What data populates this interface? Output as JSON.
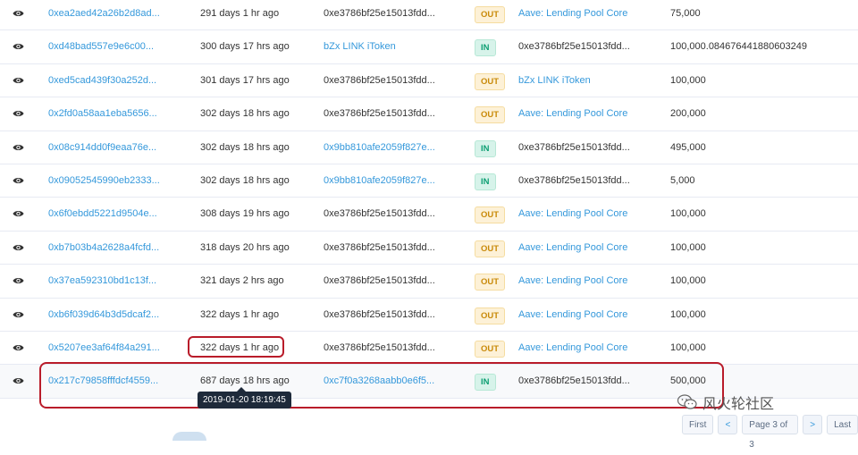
{
  "rows": [
    {
      "hash": "0xea2aed42a26b2d8ad...",
      "age": "291 days 1 hr ago",
      "from": "0xe3786bf25e15013fdd...",
      "from_link": false,
      "dir": "OUT",
      "to": "Aave: Lending Pool Core",
      "to_link": true,
      "value": "75,000"
    },
    {
      "hash": "0xd48bad557e9e6c00...",
      "age": "300 days 17 hrs ago",
      "from": "bZx LINK iToken",
      "from_link": true,
      "dir": "IN",
      "to": "0xe3786bf25e15013fdd...",
      "to_link": false,
      "value": "100,000.084676441880603249"
    },
    {
      "hash": "0xed5cad439f30a252d...",
      "age": "301 days 17 hrs ago",
      "from": "0xe3786bf25e15013fdd...",
      "from_link": false,
      "dir": "OUT",
      "to": "bZx LINK iToken",
      "to_link": true,
      "value": "100,000"
    },
    {
      "hash": "0x2fd0a58aa1eba5656...",
      "age": "302 days 18 hrs ago",
      "from": "0xe3786bf25e15013fdd...",
      "from_link": false,
      "dir": "OUT",
      "to": "Aave: Lending Pool Core",
      "to_link": true,
      "value": "200,000"
    },
    {
      "hash": "0x08c914dd0f9eaa76e...",
      "age": "302 days 18 hrs ago",
      "from": "0x9bb810afe2059f827e...",
      "from_link": true,
      "dir": "IN",
      "to": "0xe3786bf25e15013fdd...",
      "to_link": false,
      "value": "495,000"
    },
    {
      "hash": "0x09052545990eb2333...",
      "age": "302 days 18 hrs ago",
      "from": "0x9bb810afe2059f827e...",
      "from_link": true,
      "dir": "IN",
      "to": "0xe3786bf25e15013fdd...",
      "to_link": false,
      "value": "5,000"
    },
    {
      "hash": "0x6f0ebdd5221d9504e...",
      "age": "308 days 19 hrs ago",
      "from": "0xe3786bf25e15013fdd...",
      "from_link": false,
      "dir": "OUT",
      "to": "Aave: Lending Pool Core",
      "to_link": true,
      "value": "100,000"
    },
    {
      "hash": "0xb7b03b4a2628a4fcfd...",
      "age": "318 days 20 hrs ago",
      "from": "0xe3786bf25e15013fdd...",
      "from_link": false,
      "dir": "OUT",
      "to": "Aave: Lending Pool Core",
      "to_link": true,
      "value": "100,000"
    },
    {
      "hash": "0x37ea592310bd1c13f...",
      "age": "321 days 2 hrs ago",
      "from": "0xe3786bf25e15013fdd...",
      "from_link": false,
      "dir": "OUT",
      "to": "Aave: Lending Pool Core",
      "to_link": true,
      "value": "100,000"
    },
    {
      "hash": "0xb6f039d64b3d5dcaf2...",
      "age": "322 days 1 hr ago",
      "from": "0xe3786bf25e15013fdd...",
      "from_link": false,
      "dir": "OUT",
      "to": "Aave: Lending Pool Core",
      "to_link": true,
      "value": "100,000"
    },
    {
      "hash": "0x5207ee3af64f84a291...",
      "age": "322 days 1 hr ago",
      "from": "0xe3786bf25e15013fdd...",
      "from_link": false,
      "dir": "OUT",
      "to": "Aave: Lending Pool Core",
      "to_link": true,
      "value": "100,000"
    },
    {
      "hash": "0x217c79858fffdcf4559...",
      "age": "687 days 18 hrs ago",
      "from": "0xc7f0a3268aabb0e6f5...",
      "from_link": true,
      "dir": "IN",
      "to": "0xe3786bf25e15013fdd...",
      "to_link": false,
      "value": "500,000"
    }
  ],
  "tooltip": "2019-01-20 18:19:45",
  "watermark": "风火轮社区",
  "pagination": {
    "first": "First",
    "prev": "<",
    "page": "Page 3 of 3",
    "next": ">",
    "last": "Last"
  },
  "colors": {
    "link": "#3498db",
    "out_badge": "#c98a0a",
    "in_badge": "#0e9f73",
    "highlight": "#b91c2a"
  }
}
